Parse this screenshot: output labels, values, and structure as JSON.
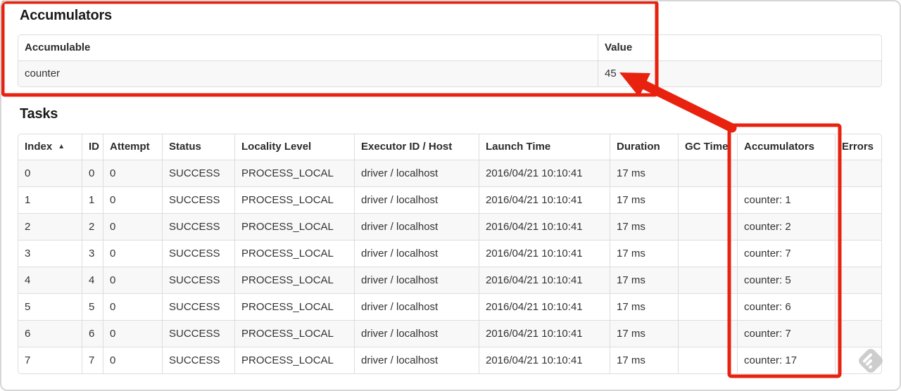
{
  "colors": {
    "annotation": "#e8220e",
    "table_border": "#dddddd",
    "row_stripe": "#f8f8f8",
    "text": "#333333",
    "watermark": "#c9c9c9"
  },
  "accumulators_section": {
    "title": "Accumulators",
    "table": {
      "headers": [
        "Accumulable",
        "Value"
      ],
      "rows": [
        [
          "counter",
          "45"
        ]
      ]
    }
  },
  "tasks_section": {
    "title": "Tasks",
    "table": {
      "headers": [
        "Index",
        "ID",
        "Attempt",
        "Status",
        "Locality Level",
        "Executor ID / Host",
        "Launch Time",
        "Duration",
        "GC Time",
        "Accumulators",
        "Errors"
      ],
      "sort_indicator": "▲",
      "rows": [
        [
          "0",
          "0",
          "0",
          "SUCCESS",
          "PROCESS_LOCAL",
          "driver / localhost",
          "2016/04/21 10:10:41",
          "17 ms",
          "",
          "",
          ""
        ],
        [
          "1",
          "1",
          "0",
          "SUCCESS",
          "PROCESS_LOCAL",
          "driver / localhost",
          "2016/04/21 10:10:41",
          "17 ms",
          "",
          "counter: 1",
          ""
        ],
        [
          "2",
          "2",
          "0",
          "SUCCESS",
          "PROCESS_LOCAL",
          "driver / localhost",
          "2016/04/21 10:10:41",
          "17 ms",
          "",
          "counter: 2",
          ""
        ],
        [
          "3",
          "3",
          "0",
          "SUCCESS",
          "PROCESS_LOCAL",
          "driver / localhost",
          "2016/04/21 10:10:41",
          "17 ms",
          "",
          "counter: 7",
          ""
        ],
        [
          "4",
          "4",
          "0",
          "SUCCESS",
          "PROCESS_LOCAL",
          "driver / localhost",
          "2016/04/21 10:10:41",
          "17 ms",
          "",
          "counter: 5",
          ""
        ],
        [
          "5",
          "5",
          "0",
          "SUCCESS",
          "PROCESS_LOCAL",
          "driver / localhost",
          "2016/04/21 10:10:41",
          "17 ms",
          "",
          "counter: 6",
          ""
        ],
        [
          "6",
          "6",
          "0",
          "SUCCESS",
          "PROCESS_LOCAL",
          "driver / localhost",
          "2016/04/21 10:10:41",
          "17 ms",
          "",
          "counter: 7",
          ""
        ],
        [
          "7",
          "7",
          "0",
          "SUCCESS",
          "PROCESS_LOCAL",
          "driver / localhost",
          "2016/04/21 10:10:41",
          "17 ms",
          "",
          "counter: 17",
          ""
        ]
      ]
    }
  }
}
